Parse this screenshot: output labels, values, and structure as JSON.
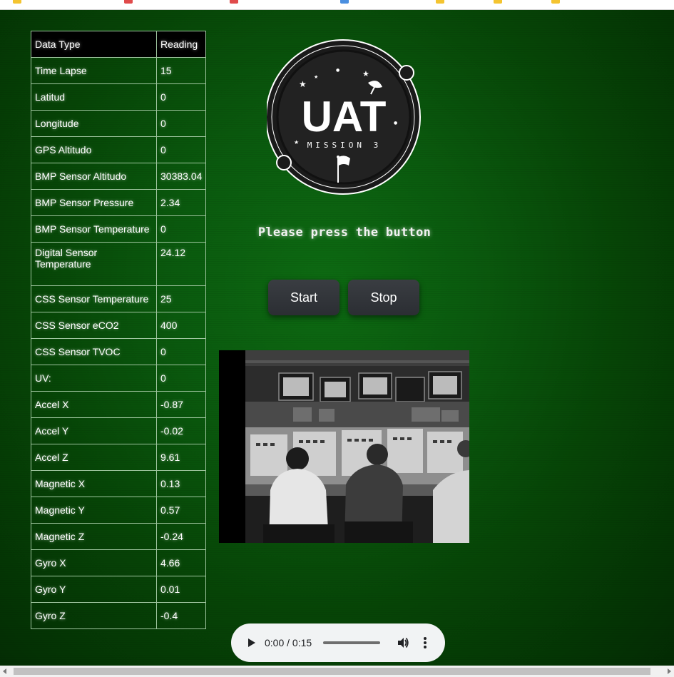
{
  "table": {
    "header": {
      "col1": "Data Type",
      "col2": "Reading"
    },
    "rows": [
      {
        "type": "Time Lapse",
        "reading": "15"
      },
      {
        "type": "Latitud",
        "reading": "0"
      },
      {
        "type": "Longitude",
        "reading": "0"
      },
      {
        "type": "GPS Altitudo",
        "reading": "0"
      },
      {
        "type": "BMP Sensor Altitudo",
        "reading": "30383.04"
      },
      {
        "type": "BMP Sensor Pressure",
        "reading": "2.34"
      },
      {
        "type": "BMP Sensor Temperature",
        "reading": "0"
      },
      {
        "type": "Digital Sensor Temperature",
        "reading": "24.12"
      },
      {
        "type": "CSS Sensor Temperature",
        "reading": "25"
      },
      {
        "type": "CSS Sensor eCO2",
        "reading": "400"
      },
      {
        "type": "CSS Sensor TVOC",
        "reading": "0"
      },
      {
        "type": "UV:",
        "reading": "0"
      },
      {
        "type": "Accel X",
        "reading": "-0.87"
      },
      {
        "type": "Accel Y",
        "reading": "-0.02"
      },
      {
        "type": "Accel Z",
        "reading": "9.61"
      },
      {
        "type": "Magnetic X",
        "reading": "0.13"
      },
      {
        "type": "Magnetic Y",
        "reading": "0.57"
      },
      {
        "type": "Magnetic Z",
        "reading": "-0.24"
      },
      {
        "type": "Gyro X",
        "reading": "4.66"
      },
      {
        "type": "Gyro Y",
        "reading": "0.01"
      },
      {
        "type": "Gyro Z",
        "reading": "-0.4"
      }
    ]
  },
  "logo": {
    "title": "UAT",
    "subtitle": "MISSION 3"
  },
  "prompt": "Please press the button",
  "buttons": {
    "start": "Start",
    "stop": "Stop"
  },
  "audio": {
    "time": "0:00 / 0:15"
  },
  "colors": {
    "background": "#0a5a0e",
    "button": "#2f3237",
    "table_border": "#9fc59f"
  },
  "icons": {
    "play": "play-icon",
    "volume": "volume-icon",
    "more": "more-vert-icon",
    "flag": "flag-icon",
    "satellite": "satellite-icon"
  }
}
